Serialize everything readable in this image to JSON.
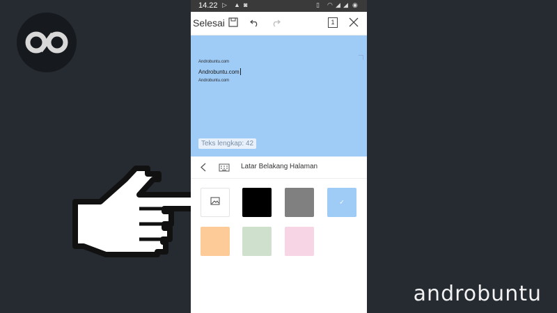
{
  "statusbar": {
    "time": "14.22",
    "icons": [
      "play-icon",
      "triangle-icon",
      "notification-icon",
      "vibrate-icon",
      "wifi-icon",
      "signal-icon",
      "signal-icon",
      "battery-icon"
    ]
  },
  "toolbar": {
    "done_label": "Selesai",
    "page_badge": "1",
    "icons": [
      "save-icon",
      "undo-icon",
      "redo-icon",
      "page-icon",
      "close-icon"
    ]
  },
  "editor": {
    "line_1": "Androbuntu.com",
    "line_2": "Androbuntu.com",
    "line_3": "Androbuntu.com",
    "char_count": "Teks lengkap: 42",
    "background_color": "#9fcbf7"
  },
  "panel": {
    "title": "Latar Belakang Halaman",
    "swatches": [
      {
        "name": "image",
        "color": "#ffffff",
        "selected": false
      },
      {
        "name": "black",
        "color": "#000000",
        "selected": false
      },
      {
        "name": "gray",
        "color": "#808080",
        "selected": false
      },
      {
        "name": "light-blue",
        "color": "#9fcbf7",
        "selected": true
      },
      {
        "name": "peach",
        "color": "#fdcb98",
        "selected": false
      },
      {
        "name": "sage",
        "color": "#cfe0cd",
        "selected": false
      },
      {
        "name": "pink",
        "color": "#f8d5e4",
        "selected": false
      }
    ]
  },
  "watermark": "androbuntu"
}
